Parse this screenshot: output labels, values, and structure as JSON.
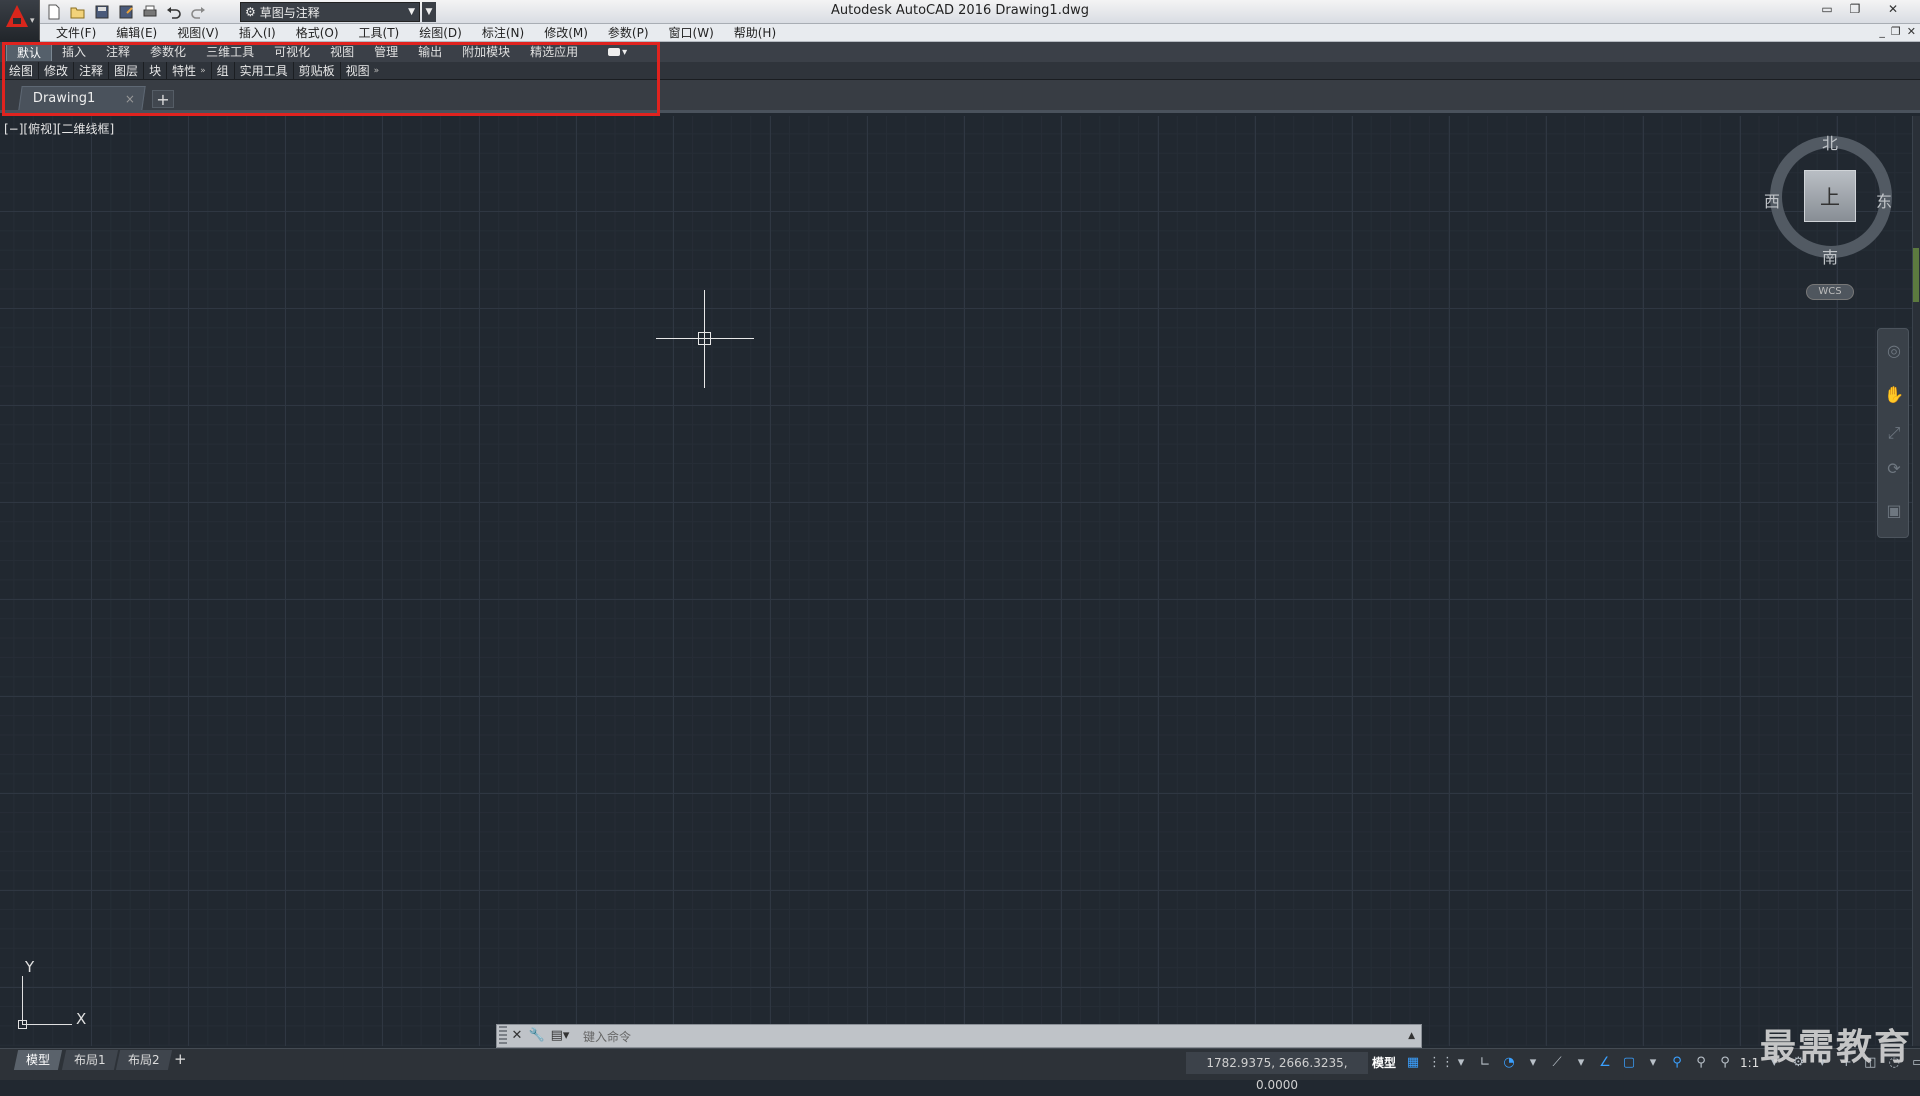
{
  "window": {
    "title": "Autodesk AutoCAD 2016    Drawing1.dwg",
    "minimize_icon": "minimize-icon",
    "restore_icon": "restore-icon",
    "close_icon": "close-icon"
  },
  "quick_access": {
    "workspace": "草图与注释",
    "icons": [
      "new-icon",
      "open-icon",
      "save-icon",
      "save-as-icon",
      "print-icon",
      "undo-icon",
      "redo-icon"
    ]
  },
  "menu": {
    "items": [
      "文件(F)",
      "编辑(E)",
      "视图(V)",
      "插入(I)",
      "格式(O)",
      "工具(T)",
      "绘图(D)",
      "标注(N)",
      "修改(M)",
      "参数(P)",
      "窗口(W)",
      "帮助(H)"
    ]
  },
  "ribbon": {
    "tabs": [
      "默认",
      "插入",
      "注释",
      "参数化",
      "三维工具",
      "可视化",
      "视图",
      "管理",
      "输出",
      "附加模块",
      "精选应用"
    ],
    "active_tab": "默认",
    "panels": [
      "绘图",
      "修改",
      "注释",
      "图层",
      "块",
      "特性",
      "组",
      "实用工具",
      "剪贴板",
      "视图"
    ],
    "more_glyph": "»"
  },
  "file_tabs": {
    "doc": "Drawing1",
    "close": "×",
    "add": "+"
  },
  "viewport": {
    "label": "[−][俯视][二维线框]"
  },
  "viewcube": {
    "north": "北",
    "south": "南",
    "east": "东",
    "west": "西",
    "face": "上",
    "wcs": "WCS"
  },
  "ucs": {
    "x": "X",
    "y": "Y"
  },
  "command_line": {
    "placeholder": "键入命令"
  },
  "layout_tabs": {
    "tabs": [
      "模型",
      "布局1",
      "布局2"
    ],
    "add": "+"
  },
  "status": {
    "coords": "1782.9375, 2666.3235, 0.0000",
    "model": "模型",
    "scale": "1:1",
    "accent": "#3aa0ff"
  },
  "watermark": "最需教育",
  "colors": {
    "canvas_bg": "#212830",
    "highlight": "#e0231f",
    "brand": "#d9261c"
  }
}
